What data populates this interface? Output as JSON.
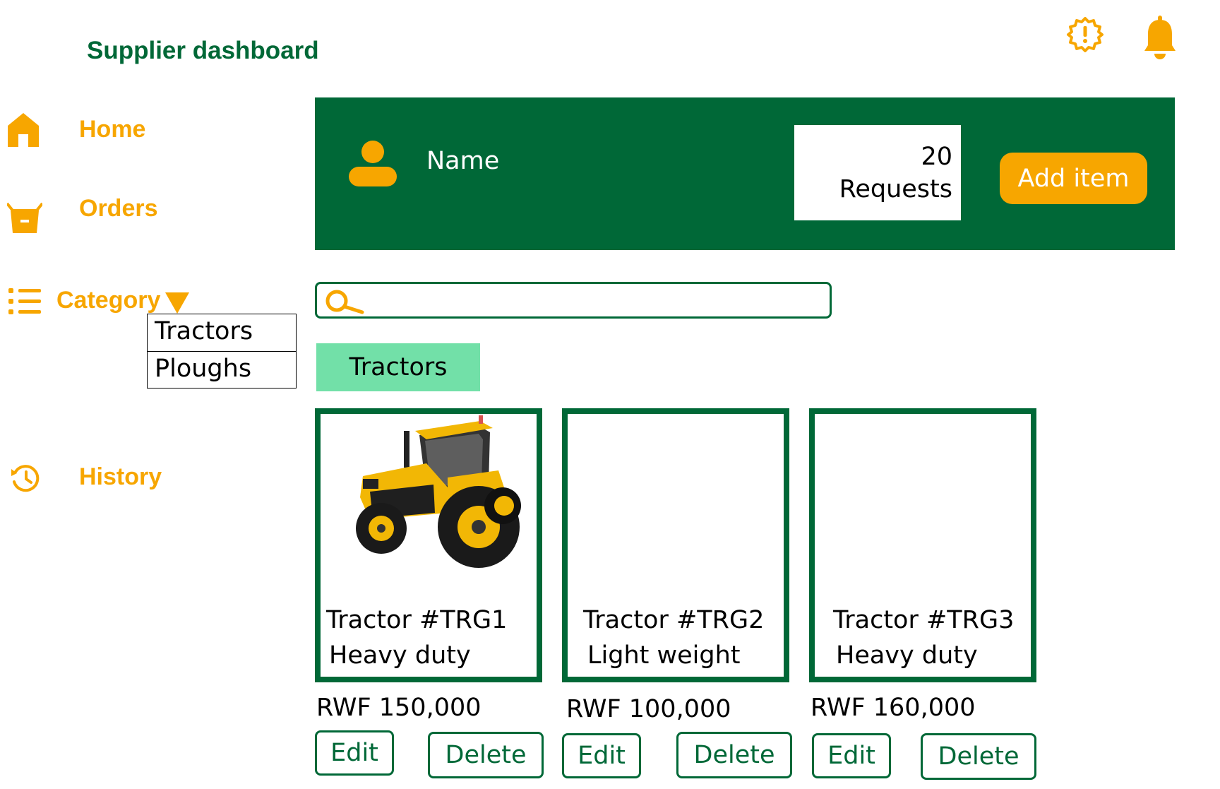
{
  "header": {
    "title": "Supplier dashboard",
    "settings_icon": "settings-alert-icon",
    "notification_icon": "bell-icon"
  },
  "colors": {
    "primary_green": "#006837",
    "accent_orange": "#F7A600",
    "chip_green": "#72E0A8"
  },
  "sidebar": {
    "items": [
      {
        "label": "Home",
        "icon": "home-icon"
      },
      {
        "label": "Orders",
        "icon": "basket-icon"
      },
      {
        "label": "Category",
        "icon": "list-icon"
      },
      {
        "label": "History",
        "icon": "history-icon"
      }
    ],
    "category_dropdown": {
      "options": [
        "Tractors",
        "Ploughs"
      ]
    }
  },
  "banner": {
    "avatar_icon": "user-icon",
    "name": "Name",
    "requests_count": "20",
    "requests_label": "Requests",
    "add_item_label": "Add item"
  },
  "search": {
    "placeholder": "",
    "value": ""
  },
  "filter": {
    "active": "Tractors"
  },
  "products": [
    {
      "title": "Tractor #TRG1",
      "subtitle": "Heavy duty",
      "price": "RWF 150,000",
      "edit_label": "Edit",
      "delete_label": "Delete",
      "has_image": true
    },
    {
      "title": "Tractor #TRG2",
      "subtitle": "Light weight",
      "price": "RWF 100,000",
      "edit_label": "Edit",
      "delete_label": "Delete",
      "has_image": false
    },
    {
      "title": "Tractor #TRG3",
      "subtitle": "Heavy duty",
      "price": "RWF 160,000",
      "edit_label": "Edit",
      "delete_label": "Delete",
      "has_image": false
    }
  ]
}
